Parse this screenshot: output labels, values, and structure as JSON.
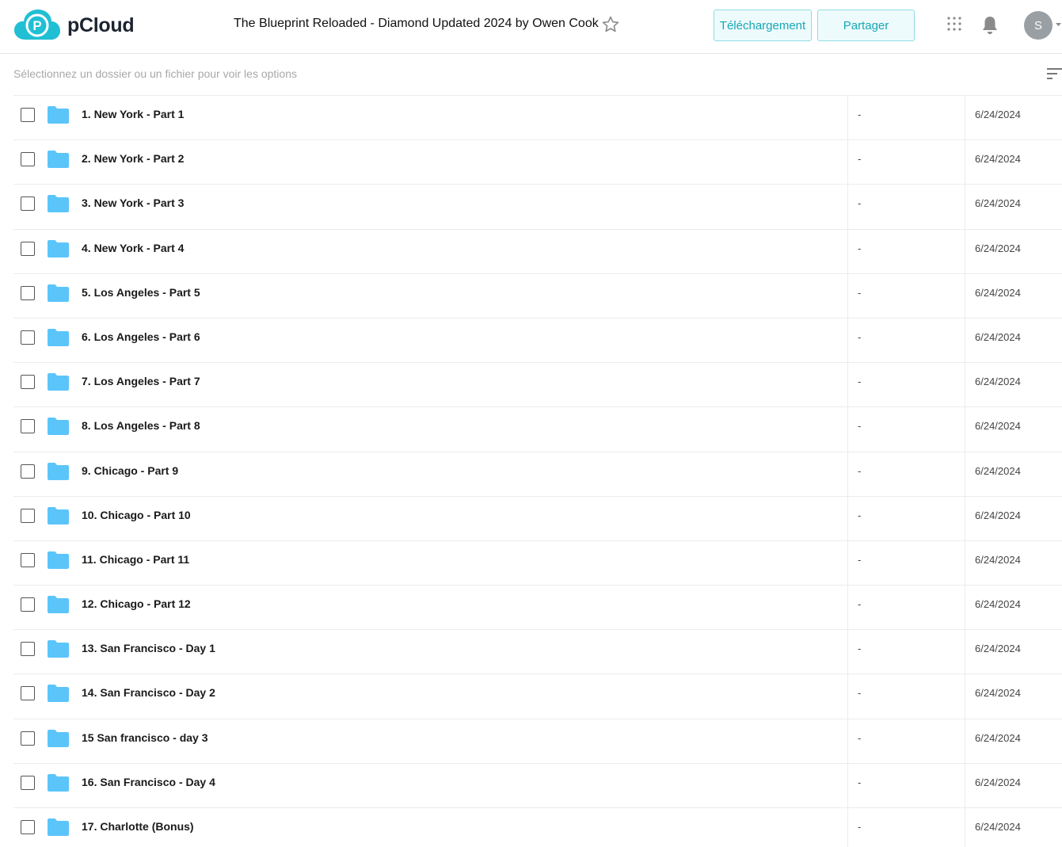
{
  "brand": {
    "name": "pCloud",
    "color": "#20bfd3"
  },
  "header": {
    "folder_title": "The Blueprint Reloaded - Diamond Updated 2024 by Owen Cook",
    "download_label": "Téléchargement",
    "share_label": "Partager",
    "avatar_initial": "S"
  },
  "toolbar": {
    "hint": "Sélectionnez un dossier ou un fichier pour voir les options"
  },
  "icons": {
    "folder": "folder-icon",
    "star": "star-icon",
    "apps": "apps-grid-icon",
    "bell": "bell-icon",
    "sort": "sort-icon"
  },
  "colors": {
    "folder": "#5bc5fa",
    "accent": "#17a7b5"
  },
  "files": [
    {
      "name": "1. New York - Part 1",
      "size": "-",
      "date": "6/24/2024"
    },
    {
      "name": "2. New York - Part 2",
      "size": "-",
      "date": "6/24/2024"
    },
    {
      "name": "3. New York - Part 3",
      "size": "-",
      "date": "6/24/2024"
    },
    {
      "name": "4. New York - Part 4",
      "size": "-",
      "date": "6/24/2024"
    },
    {
      "name": "5. Los Angeles - Part 5",
      "size": "-",
      "date": "6/24/2024"
    },
    {
      "name": "6. Los Angeles - Part 6",
      "size": "-",
      "date": "6/24/2024"
    },
    {
      "name": "7. Los Angeles - Part 7",
      "size": "-",
      "date": "6/24/2024"
    },
    {
      "name": "8. Los Angeles - Part 8",
      "size": "-",
      "date": "6/24/2024"
    },
    {
      "name": "9. Chicago - Part 9",
      "size": "-",
      "date": "6/24/2024"
    },
    {
      "name": "10. Chicago - Part 10",
      "size": "-",
      "date": "6/24/2024"
    },
    {
      "name": "11. Chicago - Part 11",
      "size": "-",
      "date": "6/24/2024"
    },
    {
      "name": "12. Chicago - Part 12",
      "size": "-",
      "date": "6/24/2024"
    },
    {
      "name": "13. San Francisco - Day 1",
      "size": "-",
      "date": "6/24/2024"
    },
    {
      "name": "14. San Francisco - Day 2",
      "size": "-",
      "date": "6/24/2024"
    },
    {
      "name": "15 San francisco - day 3",
      "size": "-",
      "date": "6/24/2024"
    },
    {
      "name": "16. San Francisco - Day 4",
      "size": "-",
      "date": "6/24/2024"
    },
    {
      "name": "17. Charlotte (Bonus)",
      "size": "-",
      "date": "6/24/2024"
    }
  ]
}
